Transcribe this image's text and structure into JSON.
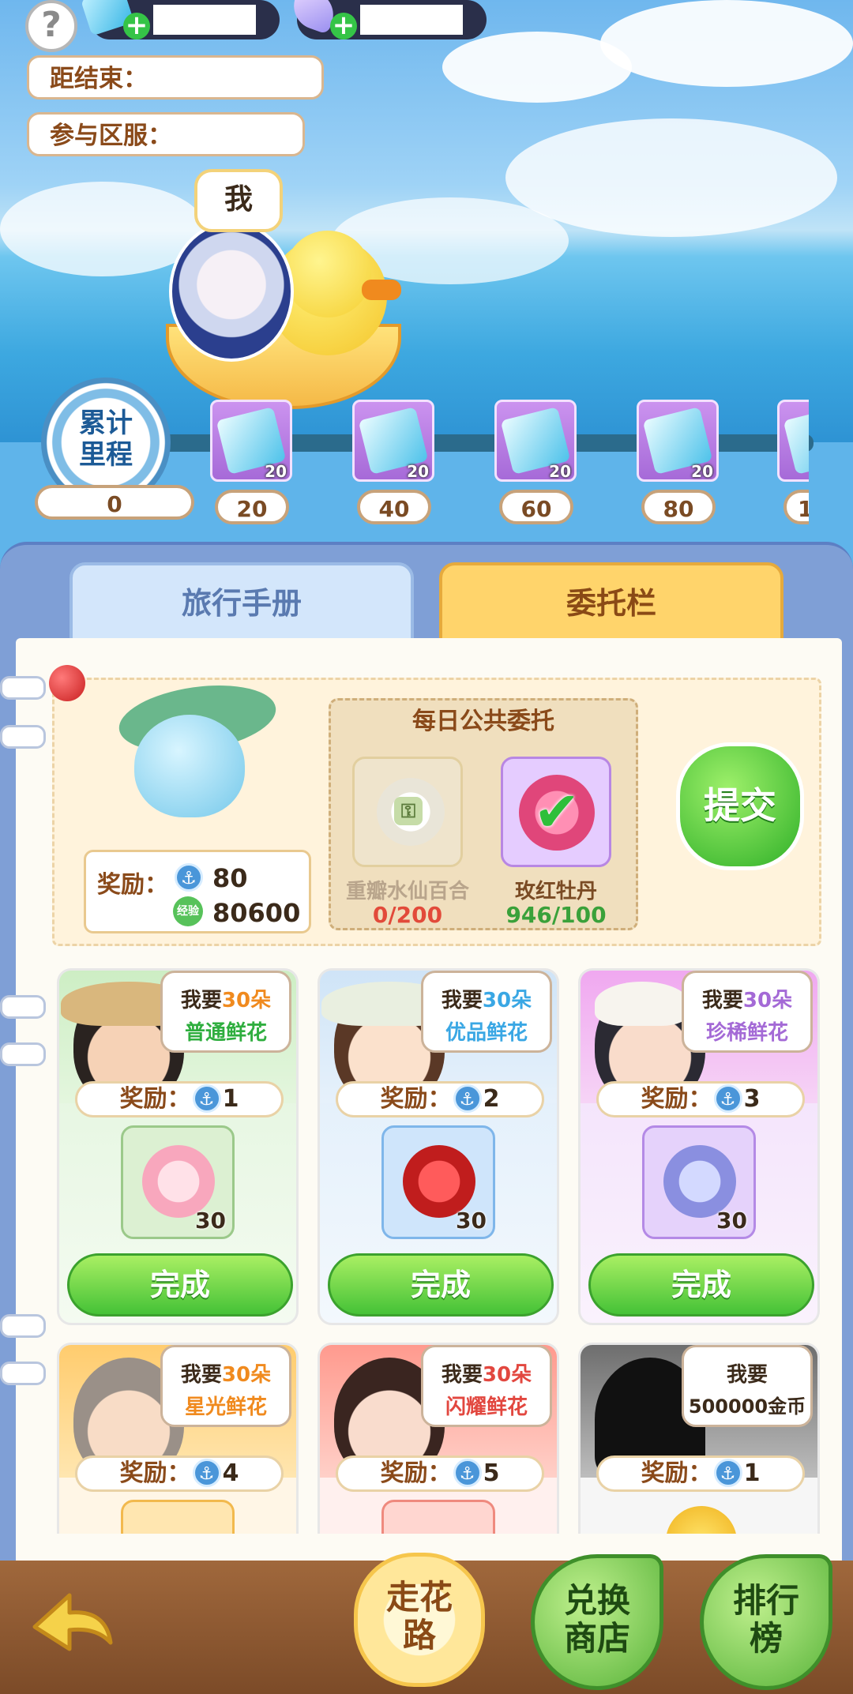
{
  "top_bar": {
    "help_icon": "question-mark",
    "currencies": [
      {
        "icon": "ticket-icon",
        "value": ""
      },
      {
        "icon": "gem-icon",
        "value": ""
      }
    ],
    "countdown_label": "距结束：",
    "server_label": "参与区服："
  },
  "player": {
    "me_label": "我"
  },
  "mileage": {
    "title": "累计里程",
    "title_l1": "累计",
    "title_l2": "里程",
    "current": "0",
    "milestones": [
      {
        "distance": "20",
        "reward_count": "20"
      },
      {
        "distance": "40",
        "reward_count": "20"
      },
      {
        "distance": "60",
        "reward_count": "20"
      },
      {
        "distance": "80",
        "reward_count": "20"
      },
      {
        "distance": "1",
        "reward_count": ""
      }
    ]
  },
  "tabs": {
    "travel": "旅行手册",
    "commission": "委托栏"
  },
  "daily": {
    "title": "每日公共委托",
    "reward_label": "奖励：",
    "reward_anchor": "80",
    "reward_exp_icon": "经验",
    "reward_exp": "80600",
    "flowers": [
      {
        "name": "重瓣水仙百合",
        "progress": "0/200",
        "locked": true
      },
      {
        "name": "玫红牡丹",
        "progress": "946/100",
        "completed": true
      }
    ],
    "submit_label": "提交"
  },
  "commissions": [
    {
      "l1": "我要",
      "qty": "30朵",
      "l2": "普通鲜花",
      "reward_label": "奖励：",
      "reward": "1",
      "item_count": "30",
      "button": "完成",
      "accent": "#2fae3f"
    },
    {
      "l1": "我要",
      "qty": "30朵",
      "l2": "优品鲜花",
      "reward_label": "奖励：",
      "reward": "2",
      "item_count": "30",
      "button": "完成",
      "accent": "#3aa7e4"
    },
    {
      "l1": "我要",
      "qty": "30朵",
      "l2": "珍稀鲜花",
      "reward_label": "奖励：",
      "reward": "3",
      "item_count": "30",
      "button": "完成",
      "accent": "#a46ad6"
    },
    {
      "l1": "我要",
      "qty": "30朵",
      "l2": "星光鲜花",
      "reward_label": "奖励：",
      "reward": "4",
      "accent": "#f08a1e"
    },
    {
      "l1": "我要",
      "qty": "30朵",
      "l2": "闪耀鲜花",
      "reward_label": "奖励：",
      "reward": "5",
      "accent": "#e2473f"
    },
    {
      "l1": "我要",
      "qty": "",
      "l2": "500000金币",
      "reward_label": "奖励：",
      "reward": "1",
      "accent": "#3b2a1a"
    }
  ],
  "bottom_bar": {
    "back_icon": "back-arrow-icon",
    "walk_l1": "走花",
    "walk_l2": "路",
    "shop_l1": "兑换",
    "shop_l2": "商店",
    "rank_l1": "排行",
    "rank_l2": "榜"
  }
}
